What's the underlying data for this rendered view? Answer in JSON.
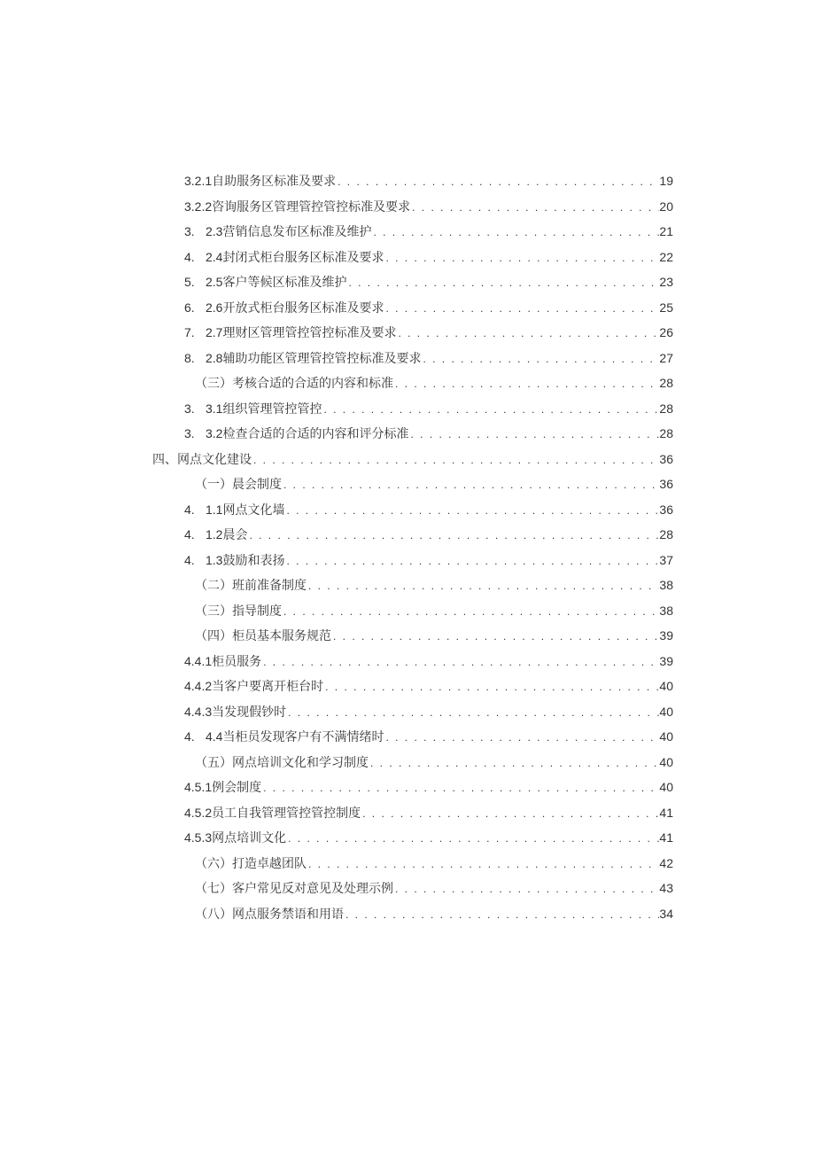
{
  "toc": [
    {
      "style": "plain",
      "indent": 1,
      "prefix": "3.2.1 ",
      "label": "自助服务区标准及要求",
      "page": "19"
    },
    {
      "style": "plain",
      "indent": 1,
      "prefix": "3.2.2 ",
      "label": "咨询服务区管理管控管控标准及要求",
      "page": "20"
    },
    {
      "style": "listnum",
      "indent": 2,
      "listnum": "3.",
      "prefix": "2.3 ",
      "label": "营销信息发布区标准及维护",
      "page": "21"
    },
    {
      "style": "listnum",
      "indent": 2,
      "listnum": "4.",
      "prefix": "2.4 ",
      "label": "封闭式柜台服务区标准及要求",
      "page": "22"
    },
    {
      "style": "listnum",
      "indent": 2,
      "listnum": "5.",
      "prefix": "2.5 ",
      "label": "客户等候区标准及维护",
      "page": "23"
    },
    {
      "style": "listnum",
      "indent": 2,
      "listnum": "6.",
      "prefix": "2.6 ",
      "label": "开放式柜台服务区标准及要求",
      "page": "25"
    },
    {
      "style": "listnum",
      "indent": 2,
      "listnum": "7.",
      "prefix": "2.7 ",
      "label": "理财区管理管控管控标准及要求",
      "page": "26"
    },
    {
      "style": "listnum",
      "indent": 2,
      "listnum": "8.",
      "prefix": "2.8 ",
      "label": "辅助功能区管理管控管控标准及要求",
      "page": "27"
    },
    {
      "style": "plain",
      "indent": 3,
      "prefix": "（三）",
      "label": "考核合适的合适的内容和标准",
      "page": "28"
    },
    {
      "style": "listnum",
      "indent": 2,
      "listnum": "3.",
      "prefix": "3.1 ",
      "label": "组织管理管控管控",
      "page": "28"
    },
    {
      "style": "listnum",
      "indent": 2,
      "listnum": "3.",
      "prefix": "3.2 ",
      "label": "检查合适的合适的内容和评分标准",
      "page": "28"
    },
    {
      "style": "chapter",
      "indent": 0,
      "prefix": "四、",
      "label": "网点文化建设",
      "page": "36"
    },
    {
      "style": "plain",
      "indent": 3,
      "prefix": "（一）",
      "label": "晨会制度",
      "page": "36"
    },
    {
      "style": "listnum",
      "indent": 2,
      "listnum": "4.",
      "prefix": "1.1 ",
      "label": "网点文化墙",
      "page": "36"
    },
    {
      "style": "listnum",
      "indent": 2,
      "listnum": "4.",
      "prefix": "1.2 ",
      "label": "晨会",
      "page": "28"
    },
    {
      "style": "listnum",
      "indent": 2,
      "listnum": "4.",
      "prefix": "1.3 ",
      "label": "鼓励和表扬",
      "page": "37"
    },
    {
      "style": "plain",
      "indent": 3,
      "prefix": "（二）",
      "label": "班前准备制度",
      "page": "38"
    },
    {
      "style": "plain",
      "indent": 3,
      "prefix": "（三）",
      "label": "指导制度",
      "page": "38"
    },
    {
      "style": "plain",
      "indent": 3,
      "prefix": "（四）",
      "label": "柜员基本服务规范",
      "page": "39"
    },
    {
      "style": "plain",
      "indent": 1,
      "prefix": "4.4.1 ",
      "label": "柜员服务",
      "page": "39"
    },
    {
      "style": "plain",
      "indent": 1,
      "prefix": "4.4.2 ",
      "label": "当客户要离开柜台时",
      "page": "40"
    },
    {
      "style": "plain",
      "indent": 1,
      "prefix": "4.4.3 ",
      "label": "当发现假钞时",
      "page": "40"
    },
    {
      "style": "listnum",
      "indent": 2,
      "listnum": "4.",
      "prefix": "4.4 ",
      "label": "当柜员发现客户有不满情绪时",
      "page": "40"
    },
    {
      "style": "plain",
      "indent": 3,
      "prefix": "（五）",
      "label": "网点培训文化和学习制度",
      "page": "40"
    },
    {
      "style": "plain",
      "indent": 1,
      "prefix": "4.5.1 ",
      "label": "例会制度",
      "page": "40"
    },
    {
      "style": "plain",
      "indent": 1,
      "prefix": "4.5.2 ",
      "label": "员工自我管理管控管控制度",
      "page": "41"
    },
    {
      "style": "plain",
      "indent": 1,
      "prefix": "4.5.3 ",
      "label": "网点培训文化",
      "page": "41"
    },
    {
      "style": "plain",
      "indent": 3,
      "prefix": "（六）",
      "label": "打造卓越团队",
      "page": "42"
    },
    {
      "style": "plain",
      "indent": 3,
      "prefix": "（七）",
      "label": "客户常见反对意见及处理示例",
      "page": "43"
    },
    {
      "style": "plain",
      "indent": 3,
      "prefix": "（八）",
      "label": "网点服务禁语和用语",
      "page": "34"
    }
  ]
}
